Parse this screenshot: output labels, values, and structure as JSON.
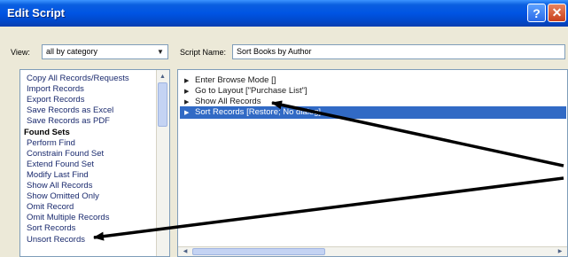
{
  "window": {
    "title": "Edit Script",
    "help_label": "?",
    "close_label": "✕"
  },
  "view": {
    "label": "View:",
    "selected": "all by category"
  },
  "script_name": {
    "label": "Script Name:",
    "value": "Sort Books by Author"
  },
  "steps_list": [
    {
      "label": "Copy All Records/Requests",
      "category": false
    },
    {
      "label": "Import Records",
      "category": false
    },
    {
      "label": "Export Records",
      "category": false
    },
    {
      "label": "Save Records as Excel",
      "category": false
    },
    {
      "label": "Save Records as PDF",
      "category": false
    },
    {
      "label": "Found Sets",
      "category": true
    },
    {
      "label": "Perform Find",
      "category": false
    },
    {
      "label": "Constrain Found Set",
      "category": false
    },
    {
      "label": "Extend Found Set",
      "category": false
    },
    {
      "label": "Modify Last Find",
      "category": false
    },
    {
      "label": "Show All Records",
      "category": false
    },
    {
      "label": "Show Omitted Only",
      "category": false
    },
    {
      "label": "Omit Record",
      "category": false
    },
    {
      "label": "Omit Multiple Records",
      "category": false
    },
    {
      "label": "Sort Records",
      "category": false
    },
    {
      "label": "Unsort Records",
      "category": false
    }
  ],
  "script_lines": [
    {
      "text": "Enter Browse Mode []",
      "selected": false
    },
    {
      "text": "Go to Layout [\"Purchase List\"]",
      "selected": false
    },
    {
      "text": "Show All Records",
      "selected": false
    },
    {
      "text": "Sort Records [Restore; No dialog]",
      "selected": true
    }
  ],
  "icons": {
    "dropdown": "chevron-down-icon",
    "bullet": "triangle-right-icon",
    "arrow": "annotation-arrow"
  },
  "colors": {
    "title_bar": "#0054e3",
    "selection": "#316ac5",
    "annotation_arrow": "#000000"
  }
}
